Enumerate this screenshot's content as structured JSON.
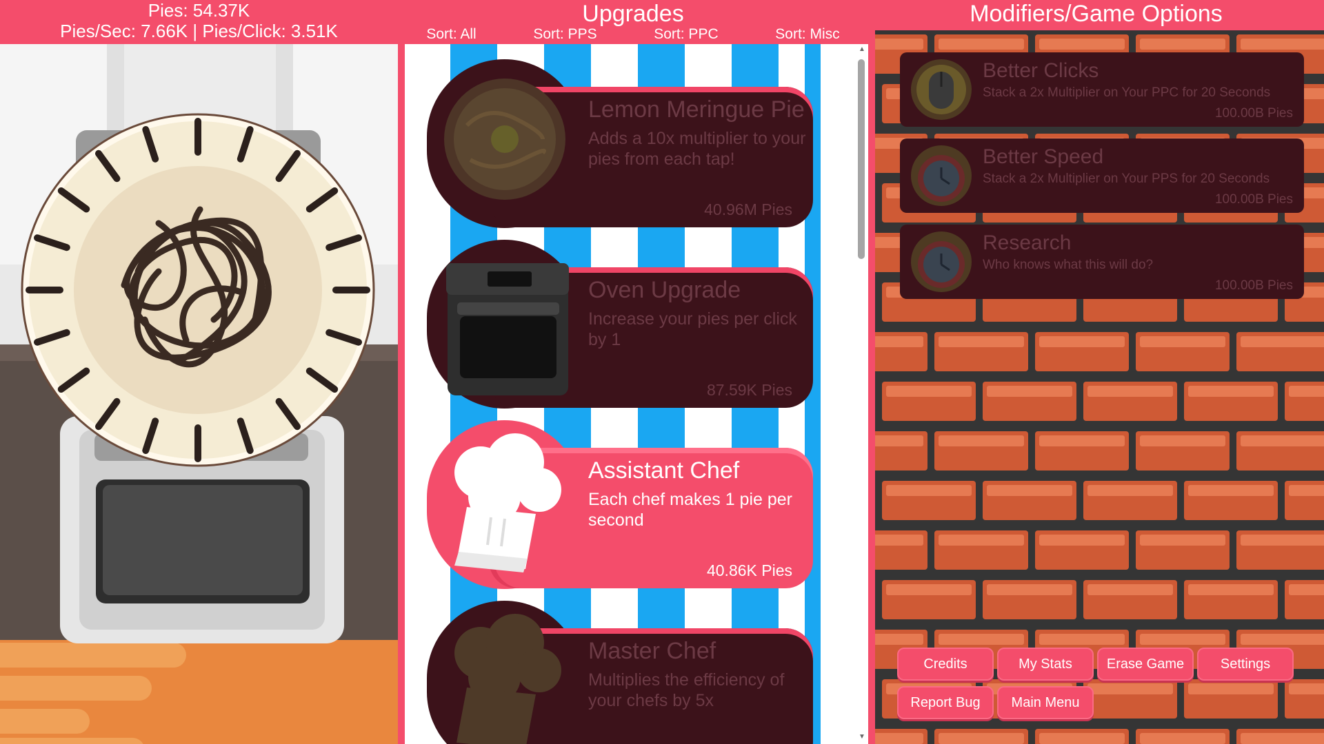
{
  "header": {
    "pies": "Pies: 54.37K",
    "rates": "Pies/Sec: 7.66K | Pies/Click: 3.51K",
    "upgrades_title": "Upgrades",
    "modifiers_title": "Modifiers/Game Options"
  },
  "sorts": [
    "Sort: All",
    "Sort: PPS",
    "Sort: PPC",
    "Sort: Misc"
  ],
  "upgrades": [
    {
      "title": "Lemon Meringue Pie",
      "desc": "Adds a 10x multiplier to your pies from each tap!",
      "cost": "40.96M Pies",
      "state": "locked",
      "icon": "lemon-meringue-pie-icon"
    },
    {
      "title": "Oven Upgrade",
      "desc": "Increase your pies per click by 1",
      "cost": "87.59K Pies",
      "state": "locked",
      "icon": "oven-icon"
    },
    {
      "title": "Assistant Chef",
      "desc": "Each chef makes 1 pie per second",
      "cost": "40.86K Pies",
      "state": "active",
      "icon": "chef-hat-icon"
    },
    {
      "title": "Master Chef",
      "desc": "Multiplies the efficiency of your chefs by 5x",
      "cost": "",
      "state": "locked",
      "icon": "master-chef-hat-icon"
    }
  ],
  "modifiers": [
    {
      "title": "Better Clicks",
      "desc": "Stack a 2x Multiplier on Your PPC for 20 Seconds",
      "cost": "100.00B Pies",
      "icon": "mouse-icon"
    },
    {
      "title": "Better Speed",
      "desc": "Stack a 2x Multiplier on Your PPS for 20 Seconds",
      "cost": "100.00B Pies",
      "icon": "stopwatch-icon"
    },
    {
      "title": "Research",
      "desc": "Who knows what this will do?",
      "cost": "100.00B Pies",
      "icon": "stopwatch-icon"
    }
  ],
  "options": {
    "credits": "Credits",
    "my_stats": "My Stats",
    "erase_game": "Erase Game",
    "settings": "Settings",
    "report_bug": "Report Bug",
    "main_menu": "Main Menu"
  },
  "colors": {
    "accent": "#f44d6b",
    "locked_card": "#3c121a",
    "stripe_blue": "#1aa7f2",
    "brick": "#cf5a35"
  }
}
